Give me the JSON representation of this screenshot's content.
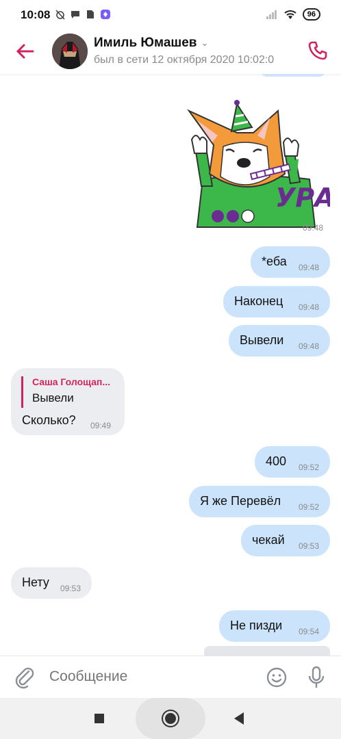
{
  "status_bar": {
    "time": "10:08",
    "battery": "96"
  },
  "header": {
    "contact_name": "Имиль Юмашев",
    "last_seen": "был в сети 12 октября 2020 10:02:0"
  },
  "sticker": {
    "text": "УРА!",
    "time": "09:48"
  },
  "messages": [
    {
      "dir": "out",
      "text": "*еба",
      "time": "09:48"
    },
    {
      "dir": "out",
      "text": "Наконец",
      "time": "09:48"
    },
    {
      "dir": "out",
      "text": "Вывели",
      "time": "09:48"
    },
    {
      "dir": "out",
      "text": "400",
      "time": "09:52"
    },
    {
      "dir": "out",
      "text": "Я же Перевёл",
      "time": "09:52"
    },
    {
      "dir": "out",
      "text": "чекай",
      "time": "09:53"
    },
    {
      "dir": "in",
      "text": "Нету",
      "time": "09:53"
    },
    {
      "dir": "out",
      "text": "Не пизди",
      "time": "09:54"
    }
  ],
  "reply_message": {
    "quote_author": "Саша Голощап...",
    "quote_text": "Вывели",
    "text": "Сколько?",
    "time": "09:49"
  },
  "composer": {
    "placeholder": "Сообщение"
  },
  "colors": {
    "accent": "#d2245c",
    "outgoing_bubble": "#cce4fb",
    "incoming_bubble": "#ebedf0"
  }
}
